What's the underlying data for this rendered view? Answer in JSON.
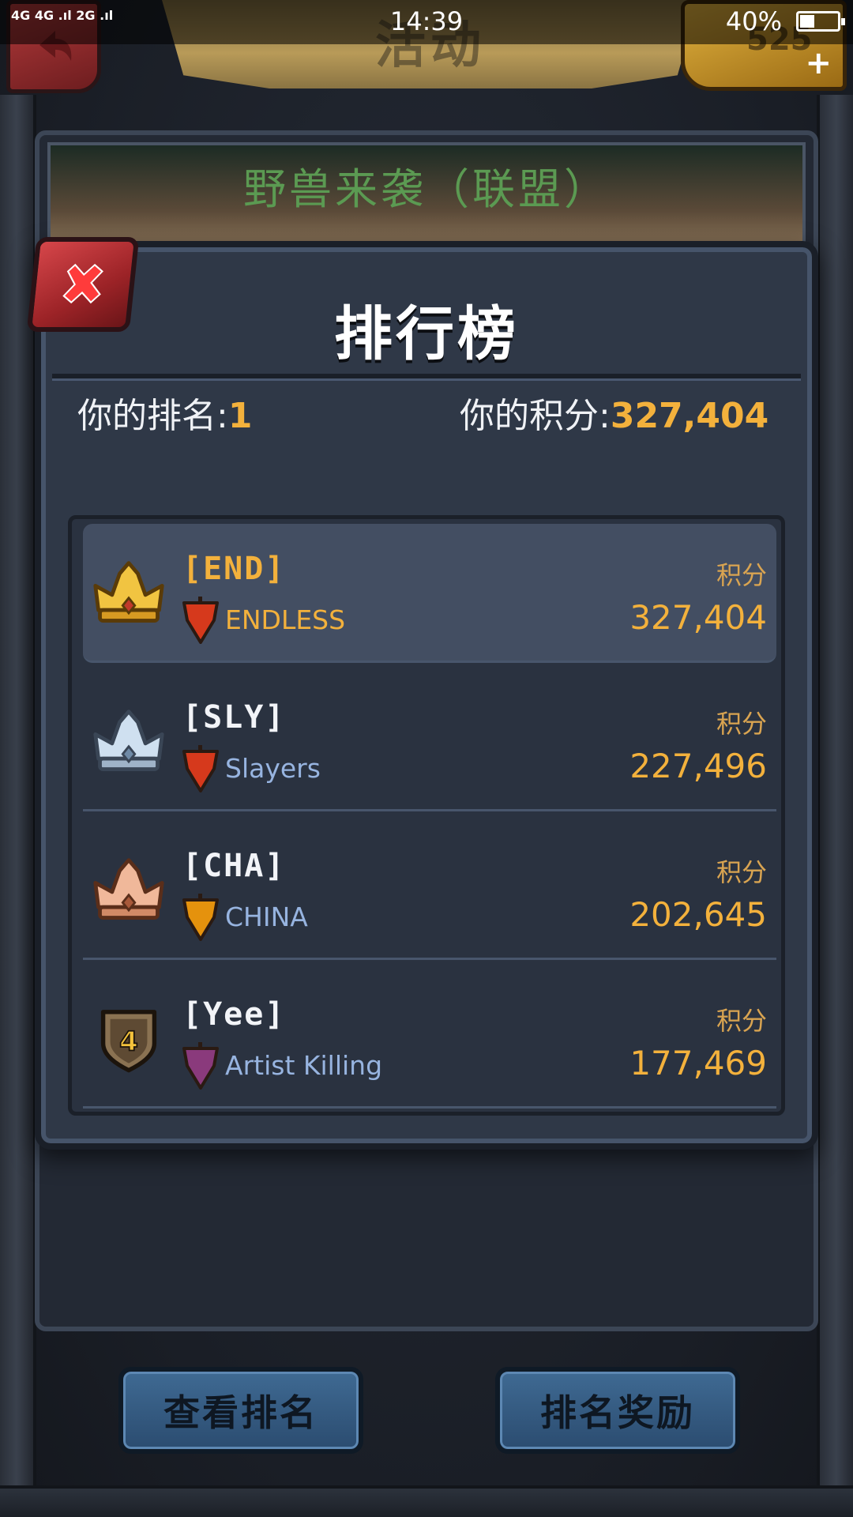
{
  "status_bar": {
    "signal_text": "4G 4G .ıl 2G .ıl",
    "time": "14:39",
    "battery": "40%",
    "battery_level_pct": 40
  },
  "header": {
    "title": "活动",
    "currency_value": "525",
    "currency_plus": "+"
  },
  "event": {
    "title": "野兽来袭（联盟）"
  },
  "leaderboard": {
    "title": "排行榜",
    "my_rank_label": "你的排名:",
    "my_rank_value": "1",
    "my_score_label": "你的积分:",
    "my_score_value": "327,404",
    "score_label": "积分",
    "rows": [
      {
        "rank": 1,
        "rank_icon": "gold-crown-icon",
        "tag": "[END]",
        "flag_color": "#d6391c",
        "name": "ENDLESS",
        "score": "327,404"
      },
      {
        "rank": 2,
        "rank_icon": "silver-crown-icon",
        "tag": "[SLY]",
        "flag_color": "#d6391c",
        "name": "Slayers",
        "score": "227,496"
      },
      {
        "rank": 3,
        "rank_icon": "bronze-crown-icon",
        "tag": "[CHA]",
        "flag_color": "#e5920d",
        "name": "CHINA",
        "score": "202,645"
      },
      {
        "rank": 4,
        "rank_icon": "rank-shield-icon",
        "rank_text": "4",
        "tag": "[Yee]",
        "flag_color": "#8a3a7c",
        "name": "Artist Killing",
        "score": "177,469"
      }
    ]
  },
  "buttons": {
    "view_ranking": "查看排名",
    "ranking_rewards": "排名奖励"
  },
  "colors": {
    "accent_gold": "#f3b13c",
    "name_blue": "#97b4e0",
    "close_red": "#b3292d",
    "button_blue": "#3f6a93"
  }
}
